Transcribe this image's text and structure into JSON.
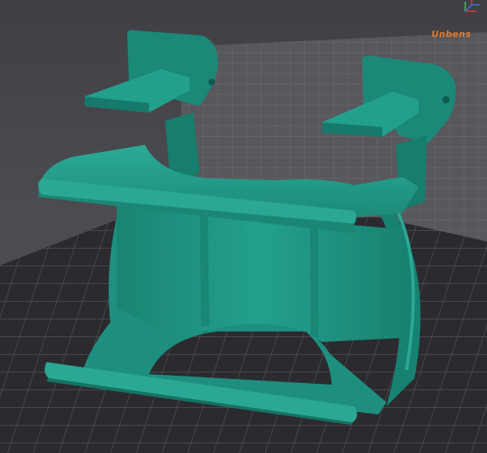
{
  "viewport": {
    "plate_label": "Unbens",
    "colors": {
      "background": "#4a4a4f",
      "plate_label": "#e07a2e",
      "model": "#1f9180",
      "model_shadow": "#157464",
      "model_highlight": "#2aa894",
      "axis_x": "#e03a3a",
      "axis_y": "#3fc25a",
      "axis_z": "#3f6fe0"
    },
    "icons": [
      "axis-gizmo-icon"
    ]
  }
}
